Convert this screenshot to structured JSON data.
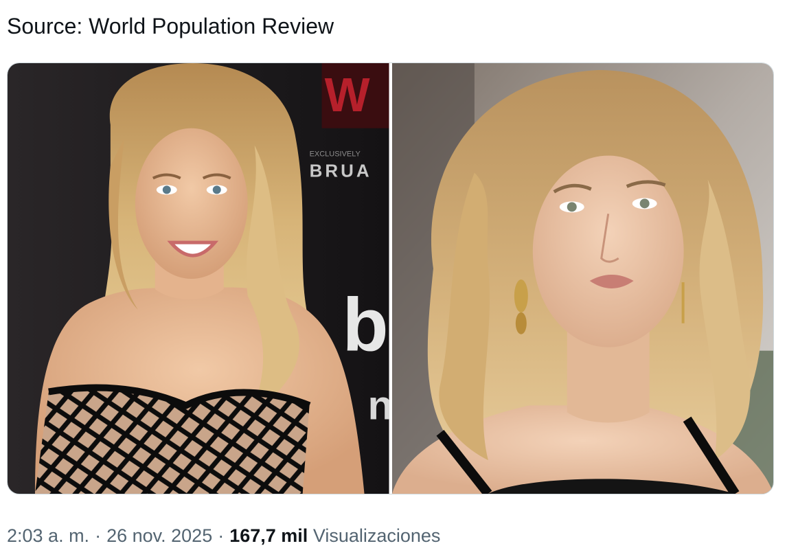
{
  "tweet": {
    "text": "Source: World Population Review"
  },
  "media": {
    "left_photo": {
      "icon": "portrait-photo-blonde-woman-smiling-black-dress",
      "backdrop_text": "BRUA",
      "backdrop_small_text": "EXCLUSIVELY"
    },
    "right_photo": {
      "icon": "portrait-photo-blonde-woman-wavy-hair"
    }
  },
  "meta": {
    "time": "2:03 a. m.",
    "separator": "·",
    "date": "26 nov. 2025",
    "views_count": "167,7 mil",
    "views_label": "Visualizaciones"
  },
  "colors": {
    "text_primary": "#0f1419",
    "text_secondary": "#536471",
    "border": "#cfd9de"
  }
}
